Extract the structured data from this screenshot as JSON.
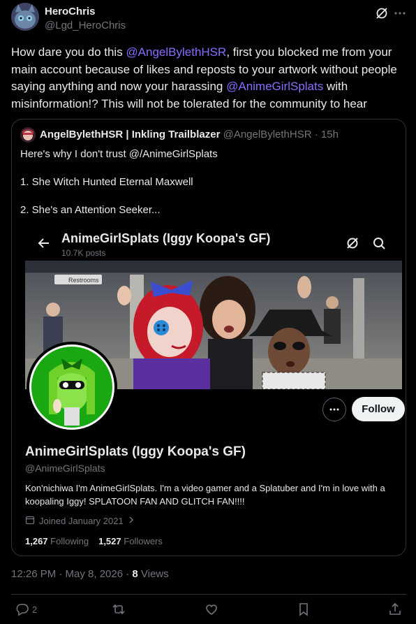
{
  "author": {
    "name": "HeroChris",
    "handle": "@Lgd_HeroChris"
  },
  "tweet": {
    "text_part1": "How dare you do this ",
    "mention1": "@AngelBylethHSR",
    "text_part2": ", first you blocked me from your main account because of likes and reposts to your artwork without people saying anything and now your harassing ",
    "mention2": "@AnimeGirlSplats",
    "text_part3": "  with misinformation!? This will not be tolerated for the community to hear"
  },
  "quote": {
    "name": "AngelBylethHSR | Inkling Trailblazer",
    "handle": "@AngelBylethHSR",
    "separator": "·",
    "time": "15h",
    "line1": "Here's why I don't trust @/AnimeGirlSplats",
    "line2": "1. She Witch Hunted Eternal Maxwell",
    "line3": "2. She's an Attention Seeker..."
  },
  "embedded_profile": {
    "title": "AnimeGirlSplats (Iggy Koopa's GF)",
    "posts": "10.7K posts",
    "follow_label": "Follow",
    "name": "AnimeGirlSplats (Iggy Koopa's GF)",
    "handle": "@AnimeGirlSplats",
    "bio": "Kon'nichiwa I'm AnimeGirlSplats. I'm a video gamer and a Splatuber and I'm in love with a koopaling Iggy! SPLATOON FAN AND GLITCH FAN!!!!",
    "joined": "Joined January 2021",
    "following_count": "1,267",
    "following_label": "Following",
    "followers_count": "1,527",
    "followers_label": "Followers",
    "banner_sign": "Restrooms"
  },
  "meta": {
    "time": "12:26 PM · May 8, 2026 · ",
    "views_count": "8",
    "views_label": " Views"
  },
  "actions": {
    "replies": "2"
  },
  "colors": {
    "background": "#000000",
    "mention": "#8b6cff",
    "muted": "#71767b",
    "border": "#2f3336",
    "text": "#e7e9ea"
  }
}
